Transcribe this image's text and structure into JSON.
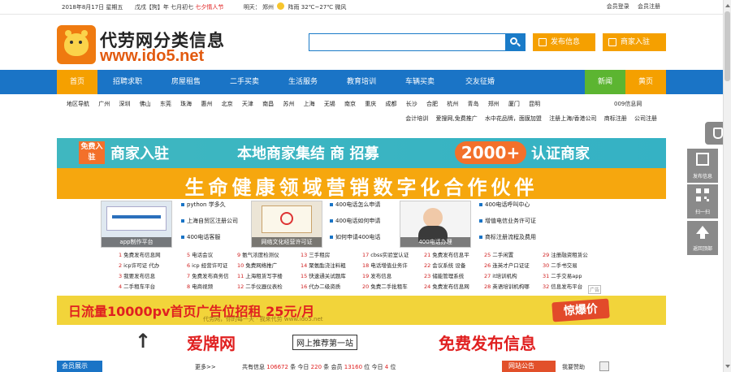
{
  "topbar": {
    "date": "2018年8月17日 星期五",
    "lunar_pre": "戊戌【狗】年 七月初七",
    "festival": "七夕情人节",
    "weather_label": "明天：",
    "city": "郑州",
    "weather_text": "阵雨",
    "temp": "32℃~27℃",
    "wind": "微风",
    "login": "会员登录",
    "register": "会员注册"
  },
  "logo": {
    "title": "代劳网分类信息",
    "url": "www.ido5.net"
  },
  "search": {
    "placeholder": "",
    "value": ""
  },
  "header_buttons": {
    "post": "发布信息",
    "join": "商家入驻"
  },
  "nav": [
    "首页",
    "招聘求职",
    "房屋租售",
    "二手买卖",
    "生活服务",
    "教育培训",
    "车辆买卖",
    "交友征婚",
    "新闻",
    "黄页"
  ],
  "cities": {
    "label": "地区导航",
    "items": [
      "广州",
      "深圳",
      "佛山",
      "东莞",
      "珠海",
      "惠州",
      "北京",
      "天津",
      "南昌",
      "苏州",
      "上海",
      "无锡",
      "南京",
      "重庆",
      "成都",
      "长沙",
      "合肥",
      "杭州",
      "青岛",
      "郑州",
      "厦门",
      "昆明"
    ],
    "right": "009信息网",
    "row2": [
      "会计培训",
      "爱搜网,免费推广",
      "水中花品牌，面膜加盟",
      "注册上海/香港公司",
      "商标注册",
      "公司注册"
    ]
  },
  "banner1": {
    "free": "免费入驻",
    "merchant": "商家入驻",
    "recruit": "本地商家集结 商  招募",
    "count": "2000+",
    "cert": "认证商家"
  },
  "banner2": {
    "text": "生命健康领域营销数字化合作伙伴"
  },
  "thumbs": [
    {
      "caption": "app制作平台"
    },
    {
      "caption": "网络文化经营许可证"
    },
    {
      "caption": "400电话办理"
    }
  ],
  "thumb_lists": [
    [
      "python 学多久",
      "上海自贸区注册公司",
      "400电话客服"
    ],
    [
      "400电话怎么申请",
      "400电话如何申请",
      "如何申请400电话"
    ],
    [
      "400电话呼叫中心",
      "增值电信业务许可证",
      "商标注册流程及费用"
    ]
  ],
  "grid": [
    [
      {
        "n": "1",
        "t": "免费发布信息网"
      },
      {
        "n": "5",
        "t": "电话会议"
      },
      {
        "n": "9",
        "t": "氨气浓度检测仪"
      },
      {
        "n": "13",
        "t": "三手租房"
      },
      {
        "n": "17",
        "t": "cbss实验室认证"
      },
      {
        "n": "21",
        "t": "免费发布信息平"
      },
      {
        "n": "25",
        "t": "二手闲置"
      },
      {
        "n": "29",
        "t": "注册融资租赁公"
      }
    ],
    [
      {
        "n": "2",
        "t": "icp许可证 代办"
      },
      {
        "n": "6",
        "t": "icp 经营许可证"
      },
      {
        "n": "10",
        "t": "免费网络推广"
      },
      {
        "n": "14",
        "t": "聚氨酯浇注料粗"
      },
      {
        "n": "18",
        "t": "电话增值业务许"
      },
      {
        "n": "22",
        "t": "会议系统 设备"
      },
      {
        "n": "26",
        "t": "连英才户口证证"
      },
      {
        "n": "30",
        "t": "二手书交易"
      }
    ],
    [
      {
        "n": "3",
        "t": "我要发布信息"
      },
      {
        "n": "7",
        "t": "免费发布商务信"
      },
      {
        "n": "11",
        "t": "上海租赁写字楼"
      },
      {
        "n": "15",
        "t": "快速通关试题库"
      },
      {
        "n": "19",
        "t": "发布信息"
      },
      {
        "n": "23",
        "t": "储能管理系统"
      },
      {
        "n": "27",
        "t": "it培训机构"
      },
      {
        "n": "31",
        "t": "二手交易app"
      }
    ],
    [
      {
        "n": "4",
        "t": "二手租车平台"
      },
      {
        "n": "8",
        "t": "电商视频"
      },
      {
        "n": "12",
        "t": "二手仪器仪表检"
      },
      {
        "n": "16",
        "t": "代办二级资质"
      },
      {
        "n": "20",
        "t": "免费二手批租车"
      },
      {
        "n": "24",
        "t": "免费发布信息网"
      },
      {
        "n": "28",
        "t": "英语培训机构哪"
      },
      {
        "n": "32",
        "t": "信息发布平台"
      }
    ]
  ],
  "ad_tag": "广告",
  "banner3": {
    "text": "日流量10000pv首页广告位招租 25元/月",
    "hot": "惊爆价",
    "sub": "代劳网，你的每一天 · 我来代劳   www.ido5.net"
  },
  "banner4": {
    "mark": "↑",
    "name": "爱牌网",
    "tag": "网上推荐第一站",
    "free": "免费发布信息"
  },
  "bottom": {
    "vip": "会员展示",
    "more": "更多>>",
    "stats_pre": "共有信息",
    "stats_info": "106672",
    "stats_mid": "条 今日",
    "stats_today": "220",
    "stats_mid2": "条 会员",
    "stats_members": "13160",
    "stats_mid3": "位 今日",
    "stats_today_members": "4",
    "stats_end": "位",
    "wanted": "网站公告",
    "mine": "我要赞助"
  },
  "float": {
    "post": "发布信息",
    "qr": "扫一扫",
    "totop": "返回顶部"
  }
}
